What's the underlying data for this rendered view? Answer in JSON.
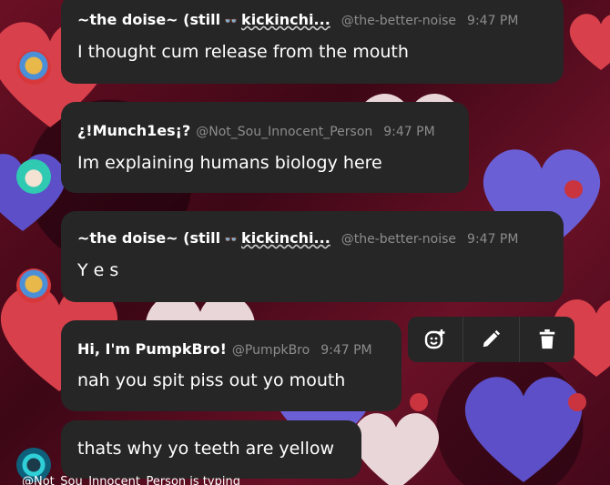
{
  "messages": [
    {
      "author": "~the doise~ (still",
      "badge": "👓",
      "author_suffix": "kickinchi...",
      "handle": "@the-better-noise",
      "time": "9:47 PM",
      "text": "I thought cum release from the mouth"
    },
    {
      "author": "¿!Munch1es¡?",
      "handle": "@Not_Sou_Innocent_Person",
      "time": "9:47 PM",
      "text": "Im explaining humans biology here"
    },
    {
      "author": "~the doise~ (still",
      "badge": "👓",
      "author_suffix": "kickinchi...",
      "handle": "@the-better-noise",
      "time": "9:47 PM",
      "text": "Y e s"
    },
    {
      "author": "Hi, I'm PumpkBro!",
      "handle": "@PumpkBro",
      "time": "9:47 PM",
      "text": "nah you spit piss out yo mouth"
    },
    {
      "text": "thats why yo teeth are yellow"
    }
  ],
  "typing_indicator": "@Not_Sou_Innocent_Person is typing",
  "toolbar": {
    "icons": [
      "add-reaction-icon",
      "edit-icon",
      "delete-icon"
    ]
  },
  "colors": {
    "bubble": "#262626",
    "meta_text": "#8c8c8c",
    "background": "#5a0d1f"
  }
}
